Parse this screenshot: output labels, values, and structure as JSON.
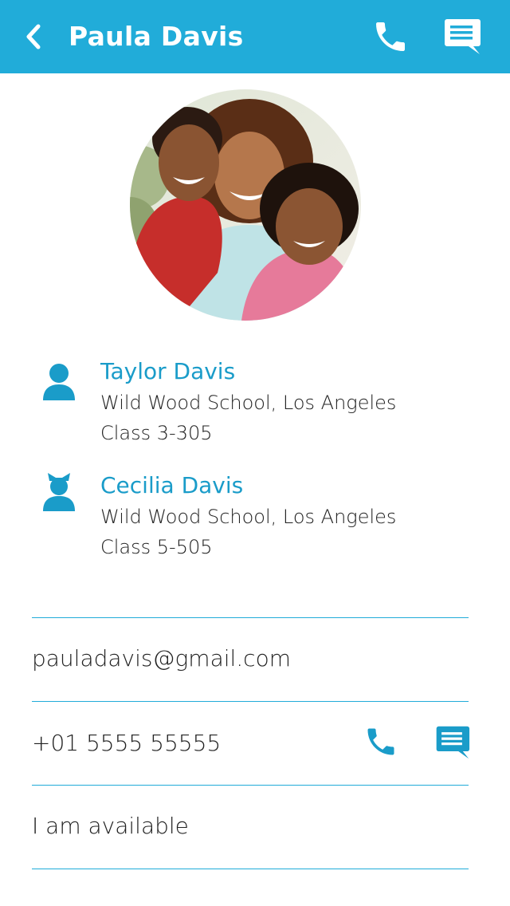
{
  "header": {
    "title": "Paula Davis",
    "back_icon": "chevron-left-icon",
    "call_icon": "phone-icon",
    "message_icon": "message-icon",
    "background_color": "#21acd9"
  },
  "profile": {
    "photo": "family-photo"
  },
  "children": [
    {
      "icon": "boy-icon",
      "name": "Taylor Davis",
      "school": "Wild Wood School, Los Angeles",
      "class": "Class 3-305"
    },
    {
      "icon": "girl-icon",
      "name": "Cecilia Davis",
      "school": "Wild Wood School, Los Angeles",
      "class": "Class 5-505"
    }
  ],
  "contact": {
    "email": "pauladavis@gmail.com",
    "phone": "+01 5555 55555",
    "status": "I am available"
  },
  "colors": {
    "accent": "#21acd9",
    "name_text": "#1a9cc9",
    "body_text": "#222222"
  }
}
